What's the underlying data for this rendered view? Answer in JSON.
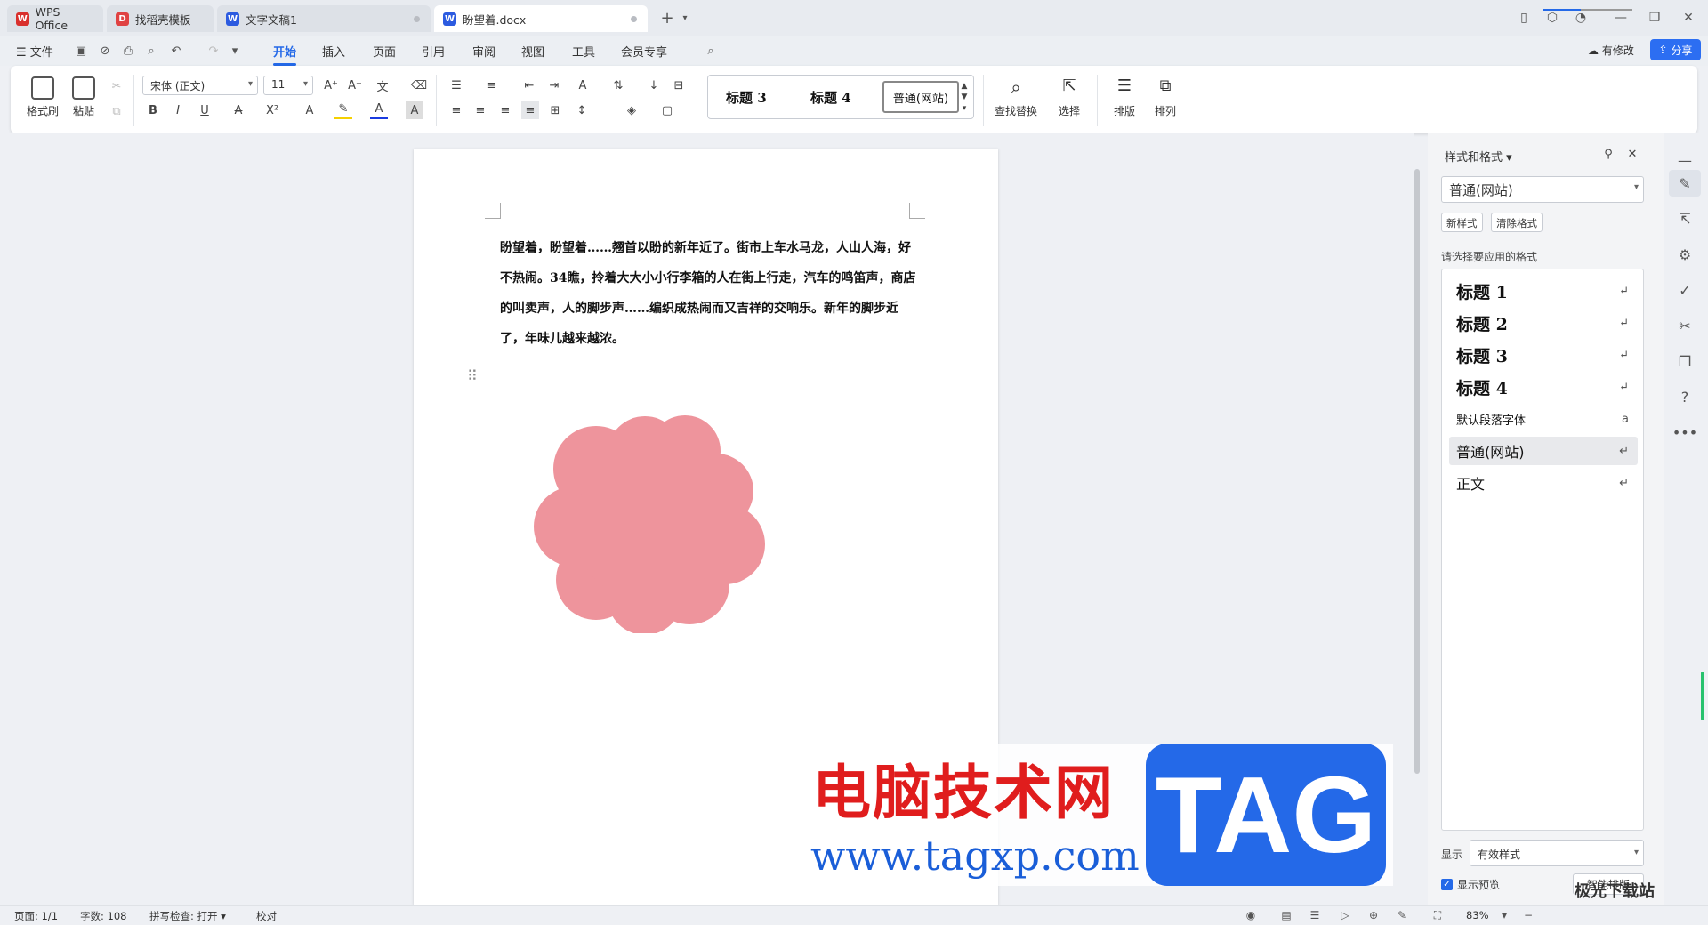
{
  "tabs": [
    {
      "label": "WPS Office",
      "color": "#d9302d"
    },
    {
      "label": "找稻壳模板",
      "color": "#e04242"
    },
    {
      "label": "文字文稿1",
      "color": "#2c5be0"
    },
    {
      "label": "盼望着.docx",
      "color": "#2c5be0"
    }
  ],
  "menu": {
    "file": "文件",
    "items": [
      "开始",
      "插入",
      "页面",
      "引用",
      "审阅",
      "视图",
      "工具",
      "会员专享"
    ],
    "modified": "有修改",
    "share": "分享"
  },
  "ribbon": {
    "format_painter": "格式刷",
    "paste": "粘贴",
    "font_name": "宋体 (正文)",
    "font_size": "11",
    "styles": [
      "标题 3",
      "标题 4",
      "普通(网站)"
    ],
    "find_replace": "查找替换",
    "select": "选择",
    "layout": "排版",
    "arrange": "排列"
  },
  "document": {
    "text": "盼望着，盼望着……翘首以盼的新年近了。街市上车水马龙，人山人海，好不热闹。34瞧，拎着大大小小行李箱的人在街上行走，汽车的鸣笛声，商店的叫卖声，人的脚步声……编织成热闹而又吉祥的交响乐。新年的脚步近了，年味儿越来越浓。",
    "shape_color": "#ee949c"
  },
  "task_pane": {
    "title": "样式和格式",
    "current_style": "普通(网站)",
    "new_style": "新样式",
    "clear_format": "清除格式",
    "prompt": "请选择要应用的格式",
    "styles": [
      {
        "label": "标题 1",
        "kind": "h"
      },
      {
        "label": "标题 2",
        "kind": "h"
      },
      {
        "label": "标题 3",
        "kind": "h"
      },
      {
        "label": "标题 4",
        "kind": "h"
      },
      {
        "label": "默认段落字体",
        "kind": "small"
      },
      {
        "label": "普通(网站)",
        "kind": "mid"
      },
      {
        "label": "正文",
        "kind": "mid"
      }
    ],
    "show_label": "显示",
    "show_value": "有效样式",
    "show_preview": "显示预览",
    "smart_layout": "智能排版"
  },
  "status": {
    "page": "页面: 1/1",
    "words": "字数: 108",
    "spell": "拼写检查: 打开",
    "proof": "校对",
    "zoom": "83%",
    "zoom_fraction": 0.42
  },
  "watermark": {
    "cn": "电脑技术网",
    "url": "www.tagxp.com",
    "tag": "TAG",
    "corner": "极光下载站"
  },
  "colors": {
    "accent": "#2469e8",
    "share": "#2c6ef2"
  }
}
